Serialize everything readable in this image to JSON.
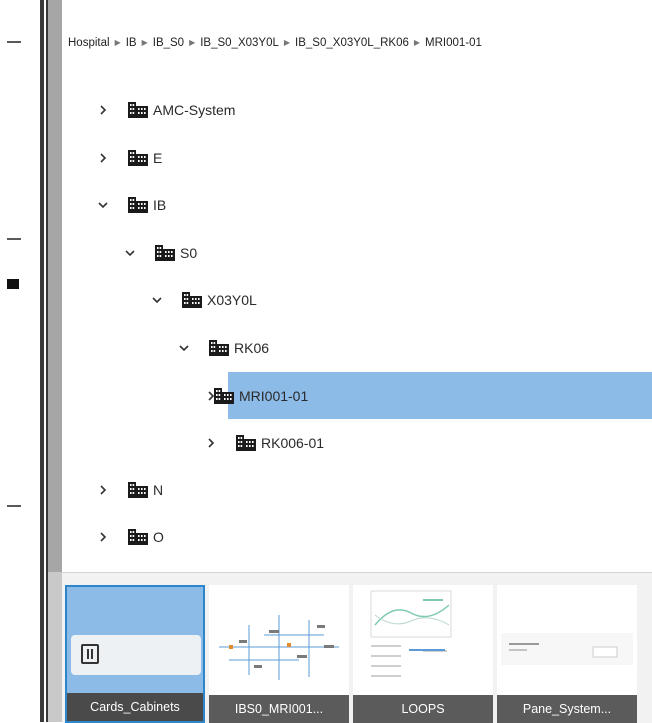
{
  "breadcrumb": [
    "Hospital",
    "IB",
    "IB_S0",
    "IB_S0_X03Y0L",
    "IB_S0_X03Y0L_RK06",
    "MRI001-01"
  ],
  "tree": [
    {
      "label": "AMC-System",
      "state": "collapsed",
      "selected": false
    },
    {
      "label": "E",
      "state": "collapsed",
      "selected": false
    },
    {
      "label": "IB",
      "state": "expanded",
      "selected": false
    },
    {
      "label": "S0",
      "state": "expanded",
      "selected": false
    },
    {
      "label": "X03Y0L",
      "state": "expanded",
      "selected": false
    },
    {
      "label": "RK06",
      "state": "expanded",
      "selected": false
    },
    {
      "label": "MRI001-01",
      "state": "collapsed",
      "selected": true
    },
    {
      "label": "RK006-01",
      "state": "collapsed",
      "selected": false
    },
    {
      "label": "N",
      "state": "collapsed",
      "selected": false
    },
    {
      "label": "O",
      "state": "collapsed",
      "selected": false
    }
  ],
  "thumbnails": [
    {
      "caption": "Cards_Cabinets",
      "active": true
    },
    {
      "caption": "IBS0_MRI001...",
      "active": false
    },
    {
      "caption": "LOOPS",
      "active": false
    },
    {
      "caption": "Pane_System...",
      "active": false
    }
  ],
  "colors": {
    "selection": "#8dbbe8",
    "active_border": "#2d86c9",
    "caption_bg": "#5b5b5b",
    "building_icon": "#1a1a1a"
  },
  "icons": {
    "tree_node": "building-icon",
    "collapsed": "chevron-right-icon",
    "expanded": "chevron-down-icon"
  }
}
